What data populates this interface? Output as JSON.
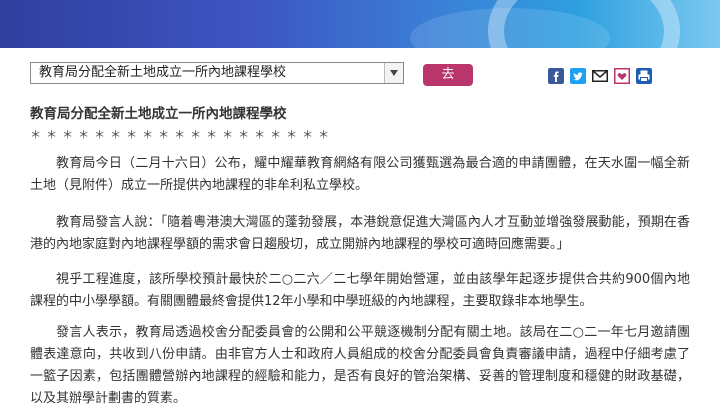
{
  "colors": {
    "go_button": "#b9356c"
  },
  "selector": {
    "value": "教育局分配全新土地成立一所內地課程學校",
    "go_label": "去"
  },
  "share_icons": [
    "facebook-icon",
    "twitter-icon",
    "email-icon",
    "bookmark-icon",
    "print-icon"
  ],
  "article": {
    "title": "教育局分配全新土地成立一所內地課程學校",
    "stars": "＊＊＊＊＊＊＊＊＊＊＊＊＊＊＊＊＊＊＊",
    "paragraphs": [
      "教育局今日（二月十六日）公布，耀中耀華教育網絡有限公司獲甄選為最合適的申請團體，在天水圍一幅全新土地（見附件）成立一所提供內地課程的非牟利私立學校。",
      "教育局發言人說：「隨着粵港澳大灣區的蓬勃發展，本港銳意促進大灣區內人才互動並增強發展動能，預期在香港的內地家庭對內地課程學額的需求會日趨殷切，成立開辦內地課程的學校可適時回應需要。」",
      "視乎工程進度，該所學校預計最快於二○二六／二七學年開始營運，並由該學年起逐步提供合共約900個內地課程的中小學學額。有關團體最終會提供12年小學和中學班級的內地課程，主要取錄非本地學生。",
      "發言人表示，教育局透過校舍分配委員會的公開和公平競逐機制分配有關土地。該局在二○二一年七月邀請團體表達意向，共收到八份申請。由非官方人士和政府人員組成的校舍分配委員會負責審議申請，過程中仔細考慮了一籃子因素，包括團體營辦內地課程的經驗和能力，是否有良好的管治架構、妥善的管理制度和穩健的財政基礎，以及其辦學計劃書的質素。"
    ]
  }
}
